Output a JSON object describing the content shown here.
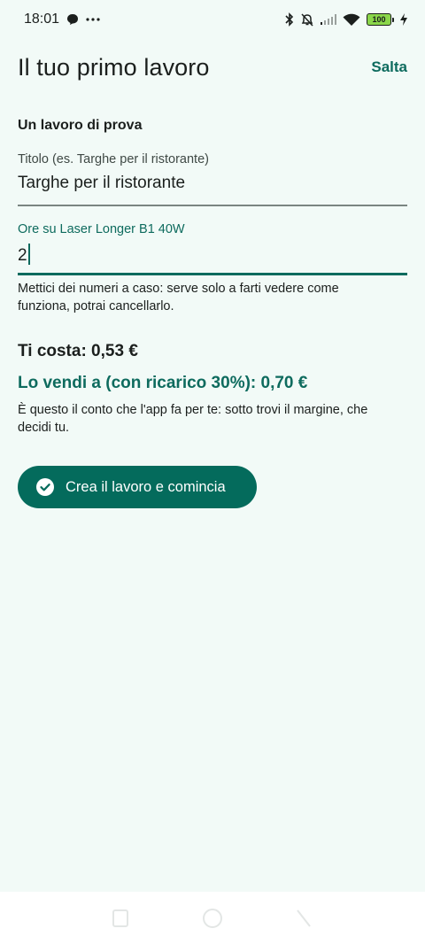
{
  "status": {
    "time": "18:01",
    "battery": "100",
    "icons": [
      "chat-bubble-icon",
      "more-icon",
      "bluetooth-icon",
      "bell-off-icon",
      "signal-icon",
      "wifi-icon",
      "battery-icon",
      "charging-icon"
    ]
  },
  "header": {
    "title": "Il tuo primo lavoro",
    "skip_label": "Salta"
  },
  "form": {
    "section_title": "Un lavoro di prova",
    "title_field": {
      "label": "Titolo (es. Targhe per il ristorante)",
      "value": "Targhe per il ristorante"
    },
    "hours_field": {
      "label": "Ore su Laser Longer B1 40W",
      "value": "2"
    },
    "helper": "Mettici dei numeri a caso: serve solo a farti vedere come funziona, potrai cancellarlo."
  },
  "summary": {
    "cost": "Ti costa: 0,53 €",
    "price": "Lo vendi a (con ricarico 30%): 0,70 €",
    "note": "È questo il conto che l'app fa per te: sotto trovi il margine, che decidi tu."
  },
  "actions": {
    "create_label": "Crea il lavoro e comincia"
  },
  "colors": {
    "accent": "#0e6b5e",
    "button": "#046b5c",
    "background": "#f2faf7"
  }
}
